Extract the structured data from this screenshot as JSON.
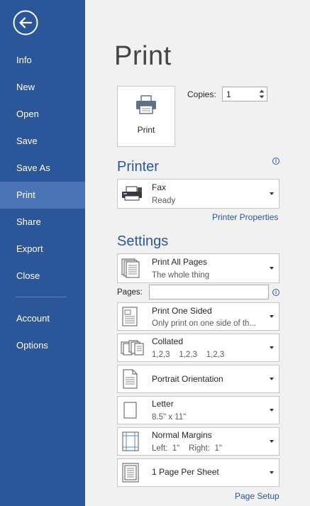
{
  "sidebar": {
    "items": [
      {
        "label": "Info"
      },
      {
        "label": "New"
      },
      {
        "label": "Open"
      },
      {
        "label": "Save"
      },
      {
        "label": "Save As"
      },
      {
        "label": "Print"
      },
      {
        "label": "Share"
      },
      {
        "label": "Export"
      },
      {
        "label": "Close"
      },
      {
        "label": "Account"
      },
      {
        "label": "Options"
      }
    ],
    "active": "Print"
  },
  "main": {
    "title": "Print",
    "print_button_label": "Print",
    "copies_label": "Copies:",
    "copies_value": "1",
    "printer_section": "Printer",
    "printer": {
      "name": "Fax",
      "status": "Ready"
    },
    "printer_properties_link": "Printer Properties",
    "settings_section": "Settings",
    "pages_label": "Pages:",
    "pages_value": "",
    "settings": [
      {
        "title": "Print All Pages",
        "subtitle": "The whole thing",
        "icon": "pages-icon"
      },
      {
        "title": "Print One Sided",
        "subtitle": "Only print on one side of th...",
        "icon": "one-sided-icon"
      },
      {
        "title": "Collated",
        "subtitle": "1,2,3    1,2,3    1,2,3",
        "icon": "collated-icon"
      },
      {
        "title": "Portrait Orientation",
        "subtitle": "",
        "icon": "portrait-icon"
      },
      {
        "title": "Letter",
        "subtitle": "8.5\" x 11\"",
        "icon": "paper-size-icon"
      },
      {
        "title": "Normal Margins",
        "subtitle": "Left:  1\"    Right:  1\"",
        "icon": "margins-icon"
      },
      {
        "title": "1 Page Per Sheet",
        "subtitle": "",
        "icon": "pages-per-sheet-icon"
      }
    ],
    "page_setup_link": "Page Setup"
  },
  "colors": {
    "sidebar": "#2b579a",
    "active_item": "#4a74b5",
    "accent": "#2b579a",
    "background": "#f1f1f1"
  }
}
